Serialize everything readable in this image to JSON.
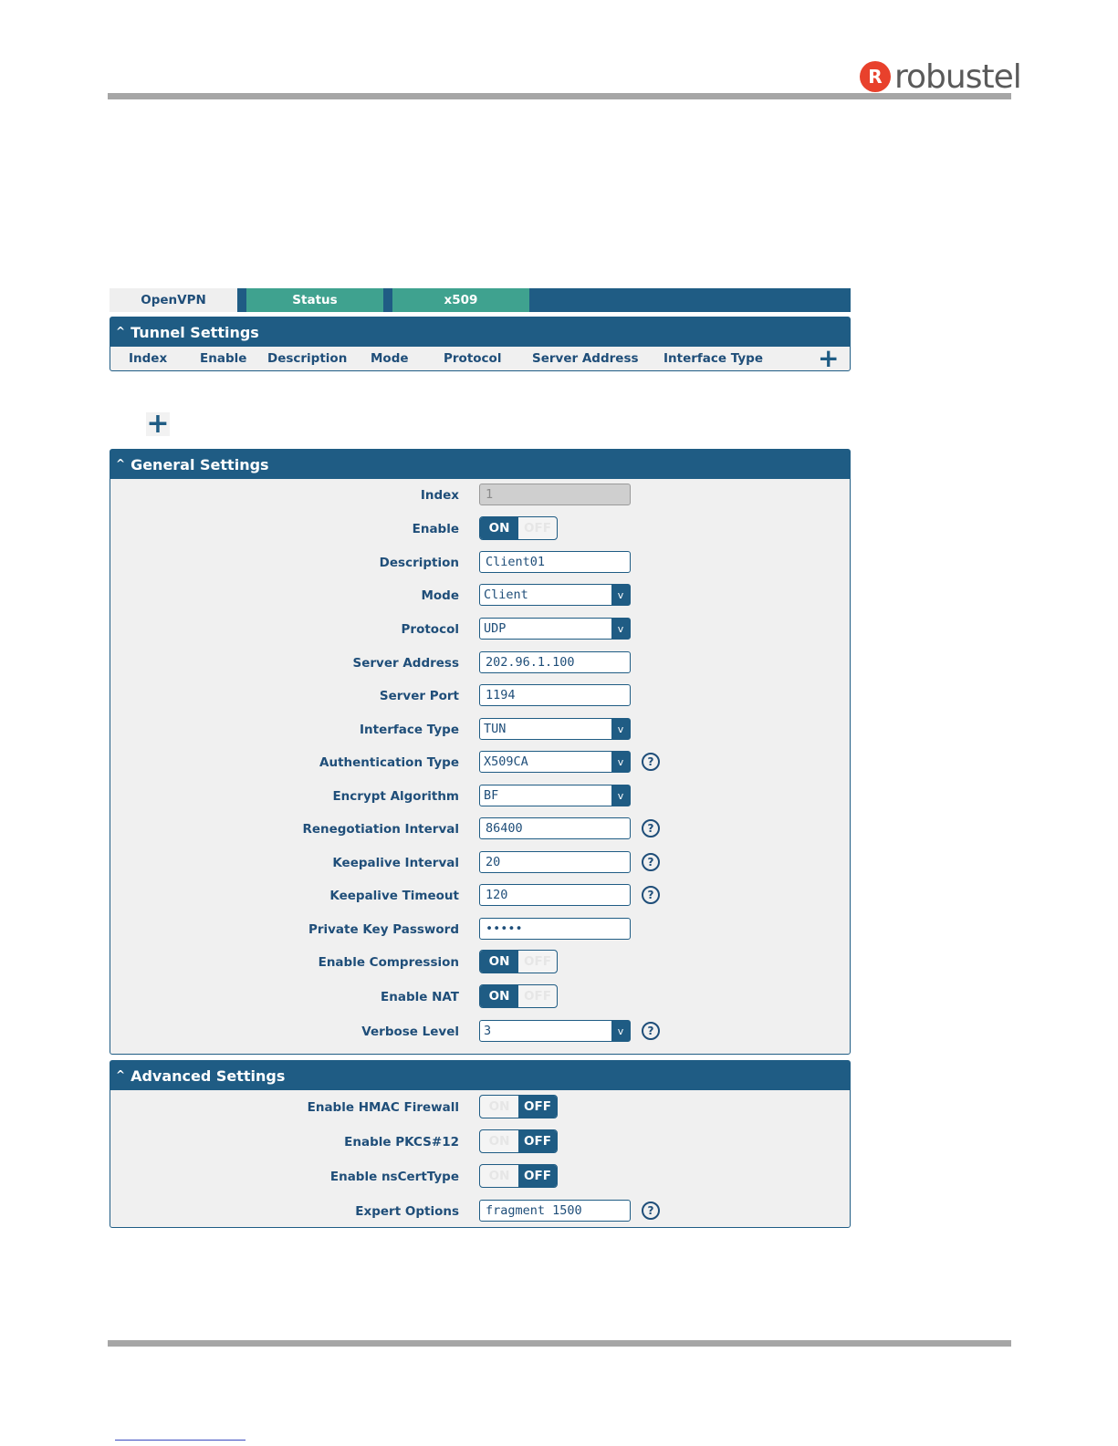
{
  "brand": {
    "badge": "R",
    "name": "robustel"
  },
  "tabs": [
    "OpenVPN",
    "Status",
    "x509"
  ],
  "tunnel": {
    "title": "Tunnel Settings",
    "columns": [
      "Index",
      "Enable",
      "Description",
      "Mode",
      "Protocol",
      "Server Address",
      "Interface Type"
    ],
    "add": "+"
  },
  "standalone_add": "+",
  "general": {
    "title": "General Settings",
    "index": {
      "label": "Index",
      "value": "1"
    },
    "enable": {
      "label": "Enable",
      "on": "ON",
      "off": "OFF",
      "state": "on"
    },
    "description": {
      "label": "Description",
      "value": "Client01"
    },
    "mode": {
      "label": "Mode",
      "value": "Client"
    },
    "protocol": {
      "label": "Protocol",
      "value": "UDP"
    },
    "server_address": {
      "label": "Server Address",
      "value": "202.96.1.100"
    },
    "server_port": {
      "label": "Server Port",
      "value": "1194"
    },
    "interface_type": {
      "label": "Interface Type",
      "value": "TUN"
    },
    "auth_type": {
      "label": "Authentication Type",
      "value": "X509CA"
    },
    "encrypt": {
      "label": "Encrypt Algorithm",
      "value": "BF"
    },
    "renegotiation": {
      "label": "Renegotiation Interval",
      "value": "86400"
    },
    "keepalive_interval": {
      "label": "Keepalive Interval",
      "value": "20"
    },
    "keepalive_timeout": {
      "label": "Keepalive Timeout",
      "value": "120"
    },
    "private_key": {
      "label": "Private Key Password",
      "value": "•••••"
    },
    "compression": {
      "label": "Enable Compression",
      "on": "ON",
      "off": "OFF",
      "state": "on"
    },
    "nat": {
      "label": "Enable NAT",
      "on": "ON",
      "off": "OFF",
      "state": "on"
    },
    "verbose": {
      "label": "Verbose Level",
      "value": "3"
    }
  },
  "advanced": {
    "title": "Advanced Settings",
    "hmac": {
      "label": "Enable HMAC Firewall",
      "on": "ON",
      "off": "OFF",
      "state": "off"
    },
    "pkcs12": {
      "label": "Enable PKCS#12",
      "on": "ON",
      "off": "OFF",
      "state": "off"
    },
    "nscert": {
      "label": "Enable nsCertType",
      "on": "ON",
      "off": "OFF",
      "state": "off"
    },
    "expert": {
      "label": "Expert Options",
      "value": "fragment 1500"
    }
  },
  "icons": {
    "help": "?",
    "caret": "^",
    "select_arrow": "v"
  },
  "colors": {
    "primary": "#1f5c84",
    "tab_inactive": "#3fa28f",
    "panel_bg": "#f0f0f0",
    "brand_red": "#e8412c"
  }
}
